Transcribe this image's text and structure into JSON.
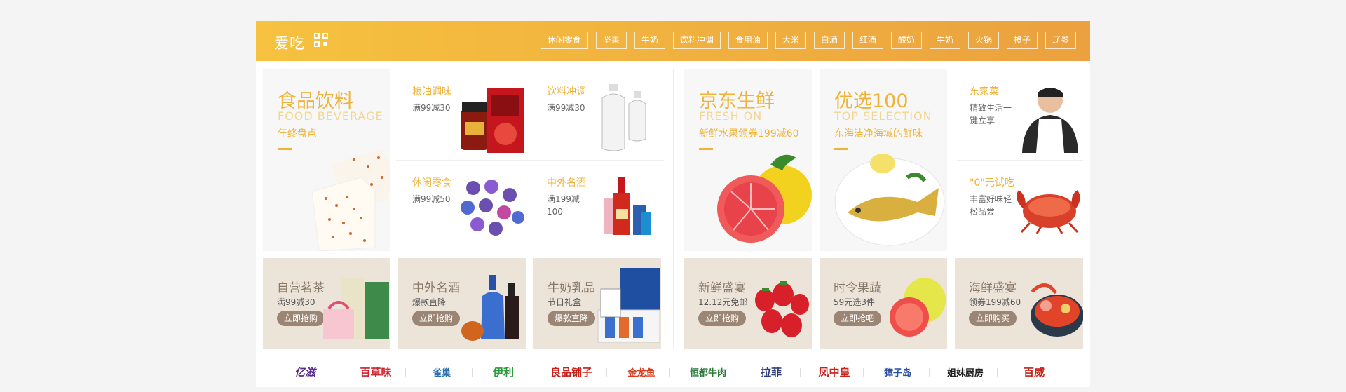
{
  "header": {
    "title": "爱吃",
    "tags": [
      "休闲零食",
      "坚果",
      "牛奶",
      "饮料冲调",
      "食用油",
      "大米",
      "白酒",
      "红酒",
      "酸奶",
      "牛奶",
      "火锅",
      "橙子",
      "辽参"
    ]
  },
  "left_big": {
    "title": "食品饮料",
    "en": "FOOD BEVERAGE",
    "sub": "年终盘点"
  },
  "left_cells": [
    {
      "title": "粮油调味",
      "desc": "满99减30"
    },
    {
      "title": "饮料冲调",
      "desc": "满99减30"
    },
    {
      "title": "休闲零食",
      "desc": "满99减50"
    },
    {
      "title": "中外名酒",
      "desc": "满199减100"
    }
  ],
  "right_big": [
    {
      "title": "京东生鲜",
      "en": "FRESH ON",
      "sub": "新鲜水果领券199减60"
    },
    {
      "title": "优选100",
      "en": "TOP SELECTION",
      "sub": "东海洁净海域的鲜味"
    }
  ],
  "right_cells": [
    {
      "title": "东家菜",
      "desc": "精致生活一键立享"
    },
    {
      "title": "\"0\"元试吃",
      "desc": "丰富好味轻松品尝"
    }
  ],
  "bottom": [
    {
      "title": "自营茗茶",
      "desc": "满99减30",
      "btn": "立即抢购"
    },
    {
      "title": "中外名酒",
      "desc": "爆款直降",
      "btn": "立即抢购"
    },
    {
      "title": "牛奶乳品",
      "desc": "节日礼盒",
      "btn": "爆款直降"
    },
    {
      "title": "新鲜盛宴",
      "desc": "12.12元免邮",
      "btn": "立即抢购"
    },
    {
      "title": "时令果蔬",
      "desc": "59元选3件",
      "btn": "立即抢吧"
    },
    {
      "title": "海鲜盛宴",
      "desc": "领券199减60",
      "btn": "立即购买"
    }
  ],
  "brands": [
    "亿滋",
    "百草味",
    "雀巢",
    "伊利",
    "良品铺子",
    "金龙鱼",
    "恒都牛肉",
    "拉菲",
    "凤中皇",
    "獐子岛",
    "姐妹厨房",
    "百威"
  ],
  "colors": {
    "accent": "#efb339",
    "header_from": "#f6c23f",
    "header_to": "#eba13f"
  }
}
